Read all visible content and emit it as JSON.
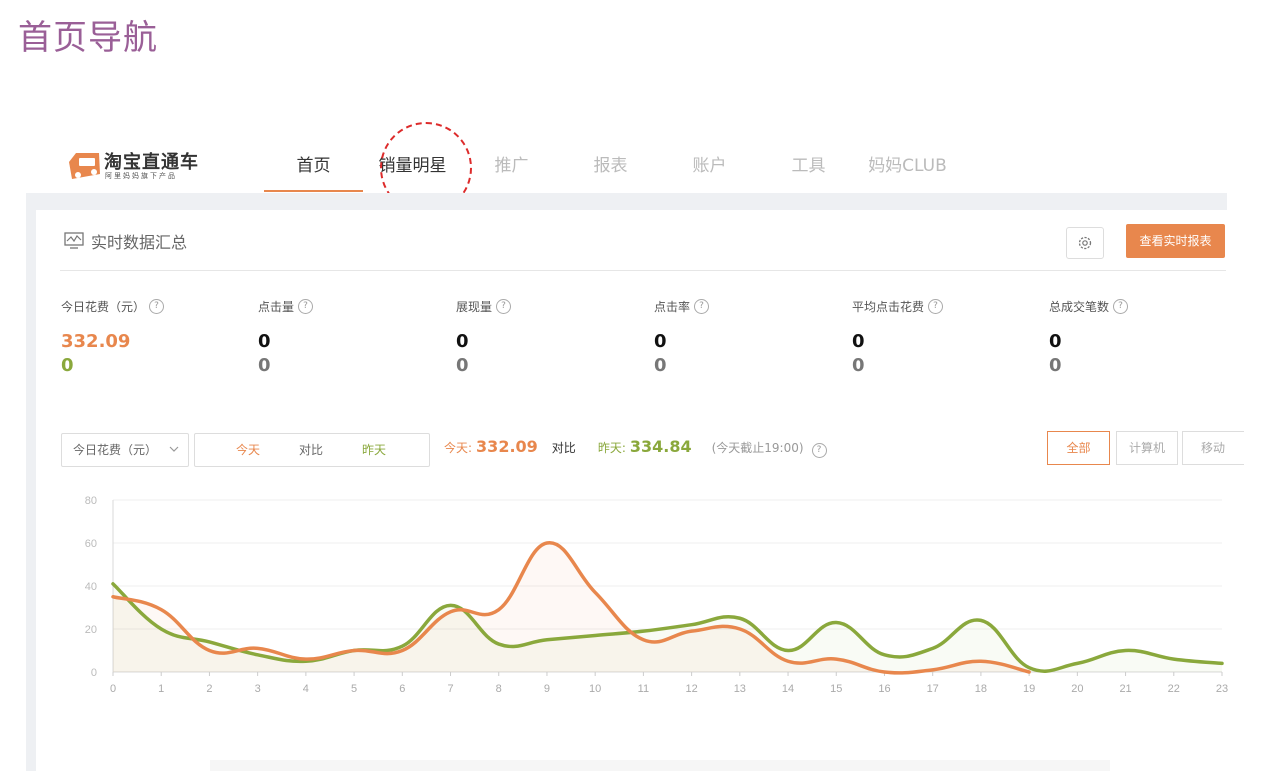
{
  "page": {
    "title": "首页导航"
  },
  "header": {
    "logo_text": "淘宝直通车",
    "logo_sub": "阿里妈妈旗下产品",
    "nav": [
      "首页",
      "销量明星",
      "推广",
      "报表",
      "账户",
      "工具",
      "妈妈CLUB"
    ],
    "active_nav": "首页"
  },
  "card": {
    "title": "实时数据汇总",
    "settings_icon": "gear-icon",
    "report_button": "查看实时报表",
    "metrics": [
      {
        "label": "今日花费（元）",
        "today": "332.09",
        "yesterday": "0"
      },
      {
        "label": "点击量",
        "today": "0",
        "yesterday": "0"
      },
      {
        "label": "展现量",
        "today": "0",
        "yesterday": "0"
      },
      {
        "label": "点击率",
        "today": "0",
        "yesterday": "0"
      },
      {
        "label": "平均点击花费",
        "today": "0",
        "yesterday": "0"
      },
      {
        "label": "总成交笔数",
        "today": "0",
        "yesterday": "0"
      }
    ]
  },
  "filter": {
    "select_value": "今日花费（元）",
    "segments": [
      "今天",
      "对比",
      "昨天"
    ],
    "today_label": "今天:",
    "today_value": "332.09",
    "compare_label": "对比",
    "yesterday_label": "昨天:",
    "yesterday_value": "334.84",
    "note": "(今天截止19:00)",
    "devices": [
      "全部",
      "计算机",
      "移动"
    ],
    "active_device": "全部"
  },
  "colors": {
    "accent": "#e8874d",
    "today": "#e8874d",
    "yesterday": "#8aa83c",
    "title": "#9a5f97"
  },
  "chart_data": {
    "type": "line",
    "x": [
      0,
      1,
      2,
      3,
      4,
      5,
      6,
      7,
      8,
      9,
      10,
      11,
      12,
      13,
      14,
      15,
      16,
      17,
      18,
      19,
      20,
      21,
      22,
      23
    ],
    "ylim": [
      0,
      80
    ],
    "yticks": [
      0,
      20,
      40,
      60,
      80
    ],
    "grid": true,
    "series": [
      {
        "name": "今天",
        "values": [
          35,
          29,
          10,
          11,
          6,
          10,
          10,
          28,
          29,
          60,
          37,
          15,
          19,
          20,
          5,
          6,
          0,
          1,
          5,
          0
        ]
      },
      {
        "name": "昨天",
        "values": [
          41,
          20,
          14,
          8,
          5,
          10,
          12,
          31,
          13,
          15,
          17,
          19,
          22,
          25,
          10,
          23,
          8,
          11,
          24,
          2,
          4,
          10,
          6,
          4
        ]
      }
    ]
  }
}
